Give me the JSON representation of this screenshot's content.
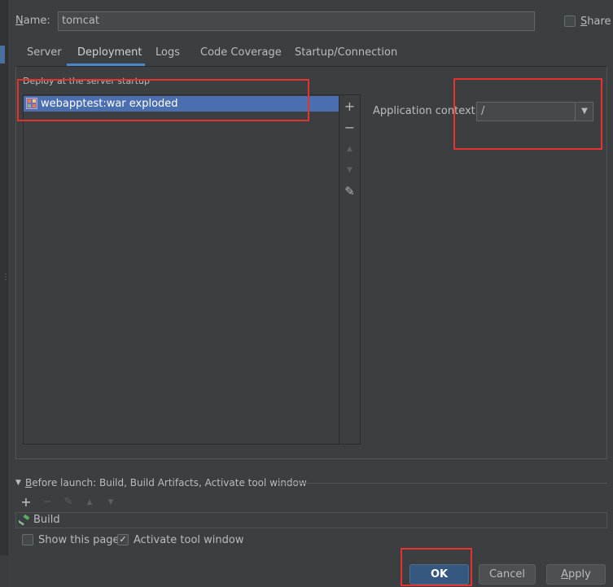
{
  "dialog": {
    "name_label_first": "N",
    "name_label_rest": "ame:",
    "name_value": "tomcat",
    "share_label_first": "S",
    "share_label_rest": "hare"
  },
  "tabs": [
    {
      "label": "Server"
    },
    {
      "label": "Deployment",
      "selected": true
    },
    {
      "label": "Logs"
    },
    {
      "label": "Code Coverage"
    },
    {
      "label": "Startup/Connection"
    }
  ],
  "deployment": {
    "legend": "Deploy at the server startup",
    "artifacts": [
      {
        "label": "webapptest:war exploded",
        "selected": true
      }
    ],
    "toolbar": {
      "add": "+",
      "remove": "−",
      "up": "▲",
      "down": "▼",
      "edit": "✎"
    },
    "context_label": "Application context:",
    "context_value": "/",
    "dropdown_arrow": "▼"
  },
  "before_launch": {
    "arrow": "▼",
    "title_first": "B",
    "title_rest": "efore launch: Build, Build Artifacts, Activate tool window",
    "toolbar": {
      "add": "+",
      "remove": "−",
      "edit": "✎",
      "up": "▲",
      "down": "▼"
    },
    "tasks": [
      {
        "label": "Build"
      }
    ]
  },
  "options": {
    "show_page_label": "Show this page",
    "show_page_checked": false,
    "activate_label": "Activate tool window",
    "activate_checked": true,
    "check_glyph": "✓"
  },
  "buttons": {
    "ok": "OK",
    "cancel": "Cancel",
    "apply_first": "A",
    "apply_rest": "pply"
  },
  "colors": {
    "background": "#3c3f41",
    "selection": "#4b6eaf",
    "accent": "#4a88c7",
    "ok_button": "#365880",
    "annotation_red": "#e5322d"
  }
}
